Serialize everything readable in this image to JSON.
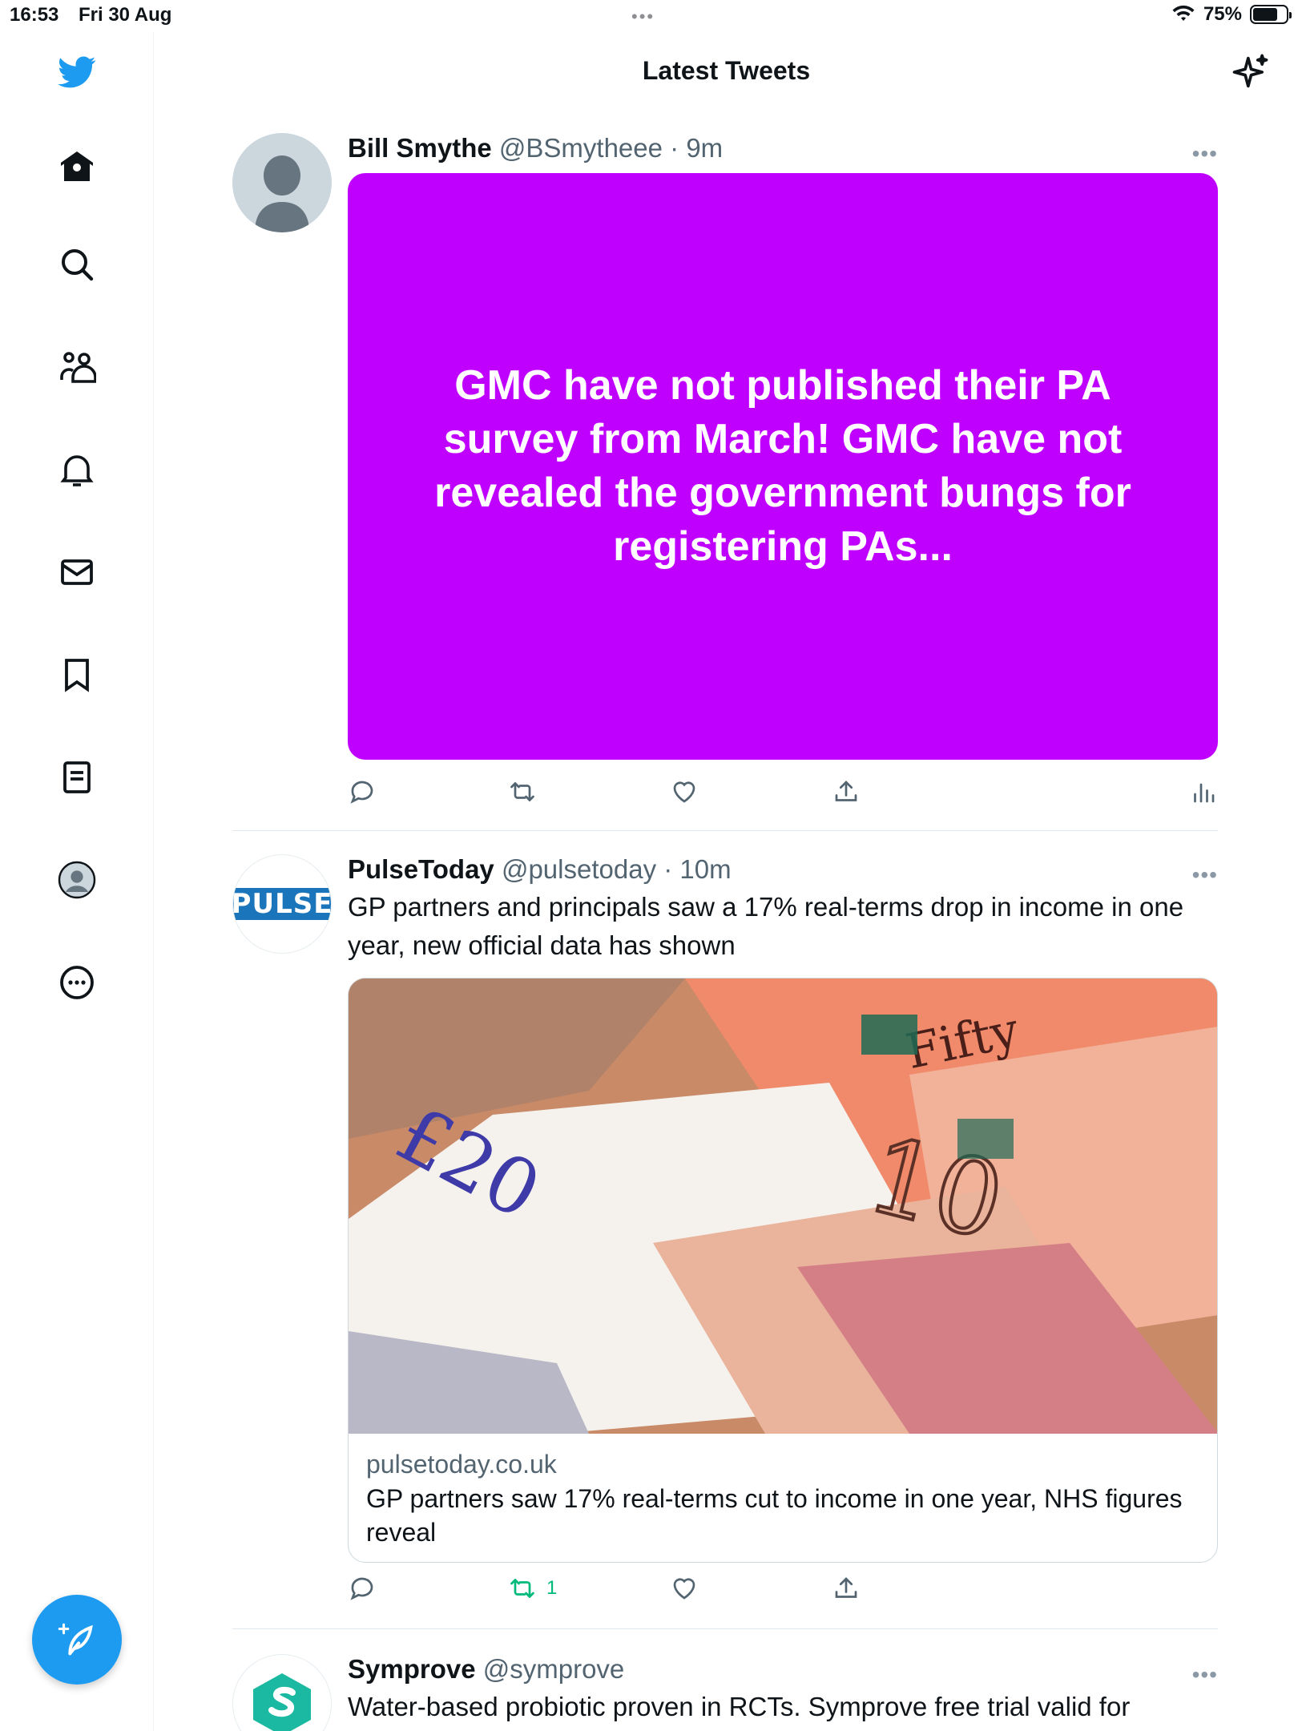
{
  "status_bar": {
    "time": "16:53",
    "date": "Fri 30 Aug",
    "battery": "75%",
    "battery_level": 0.75
  },
  "header": {
    "title": "Latest Tweets"
  },
  "sidebar": {
    "items": [
      {
        "icon": "twitter-bird-icon"
      },
      {
        "icon": "home-icon"
      },
      {
        "icon": "search-icon"
      },
      {
        "icon": "communities-icon"
      },
      {
        "icon": "bell-icon"
      },
      {
        "icon": "mail-icon"
      },
      {
        "icon": "bookmark-icon"
      },
      {
        "icon": "lists-icon"
      },
      {
        "icon": "profile-avatar-icon"
      },
      {
        "icon": "more-circle-icon"
      }
    ],
    "compose_icon": "compose-tweet-icon"
  },
  "tweets": [
    {
      "name": "Bill Smythe",
      "handle": "@BSmytheee",
      "time": "· 9m",
      "card_text": "GMC have not published their PA survey from March! GMC have not revealed the government bungs for registering PAs...",
      "card_color": "#c000ff"
    },
    {
      "name": "PulseToday",
      "handle": "@pulsetoday",
      "time": "· 10m",
      "text": "GP partners and principals saw a 17% real-terms drop in income in one year, new official data has shown",
      "logo_text": "PULSE",
      "link": {
        "domain": "pulsetoday.co.uk",
        "title": "GP partners saw 17% real-terms cut to income in one year, NHS figures reveal"
      },
      "retweet_count": "1"
    },
    {
      "name": "Symprove",
      "handle": "@symprove",
      "text": "Water-based probiotic proven in RCTs. Symprove free trial valid for"
    }
  ],
  "colors": {
    "accent": "#1d9bf0",
    "retweet_green": "#00ba7c"
  }
}
